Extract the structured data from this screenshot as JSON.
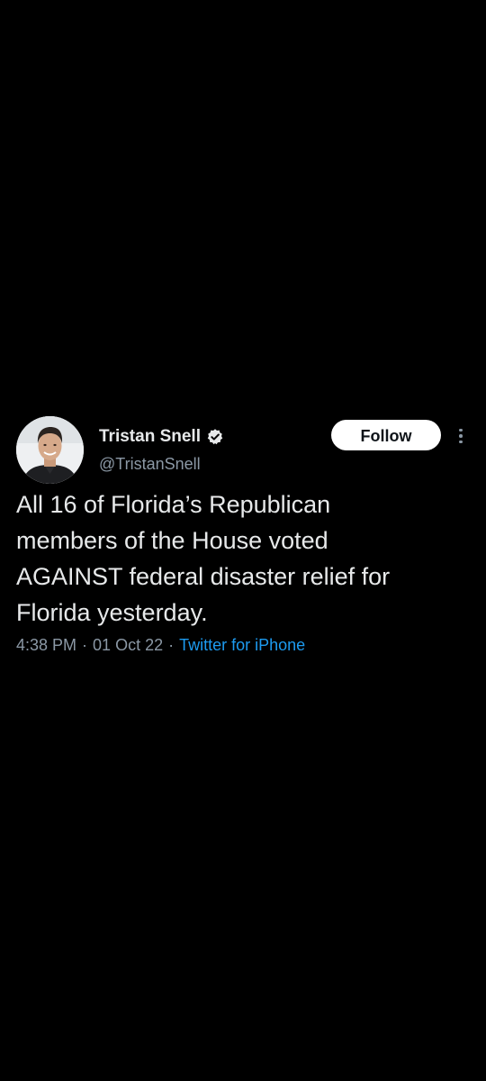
{
  "tweet": {
    "author": {
      "display_name": "Tristan Snell",
      "handle": "@TristanSnell",
      "verified": true
    },
    "follow_label": "Follow",
    "text": "All 16 of Florida’s Republican\nmembers of the House voted\nAGAINST federal disaster relief for\nFlorida yesterday.",
    "time": "4:38 PM",
    "date": "01 Oct 22",
    "separator": "·",
    "source": "Twitter for iPhone"
  },
  "colors": {
    "background": "#000000",
    "primary_text": "#e7e9ea",
    "secondary_text": "#8b98a5",
    "link": "#1d9bf0",
    "follow_button_bg": "#ffffff"
  },
  "icons": {
    "verified": "verified-badge-icon",
    "more": "more-vertical-icon"
  }
}
